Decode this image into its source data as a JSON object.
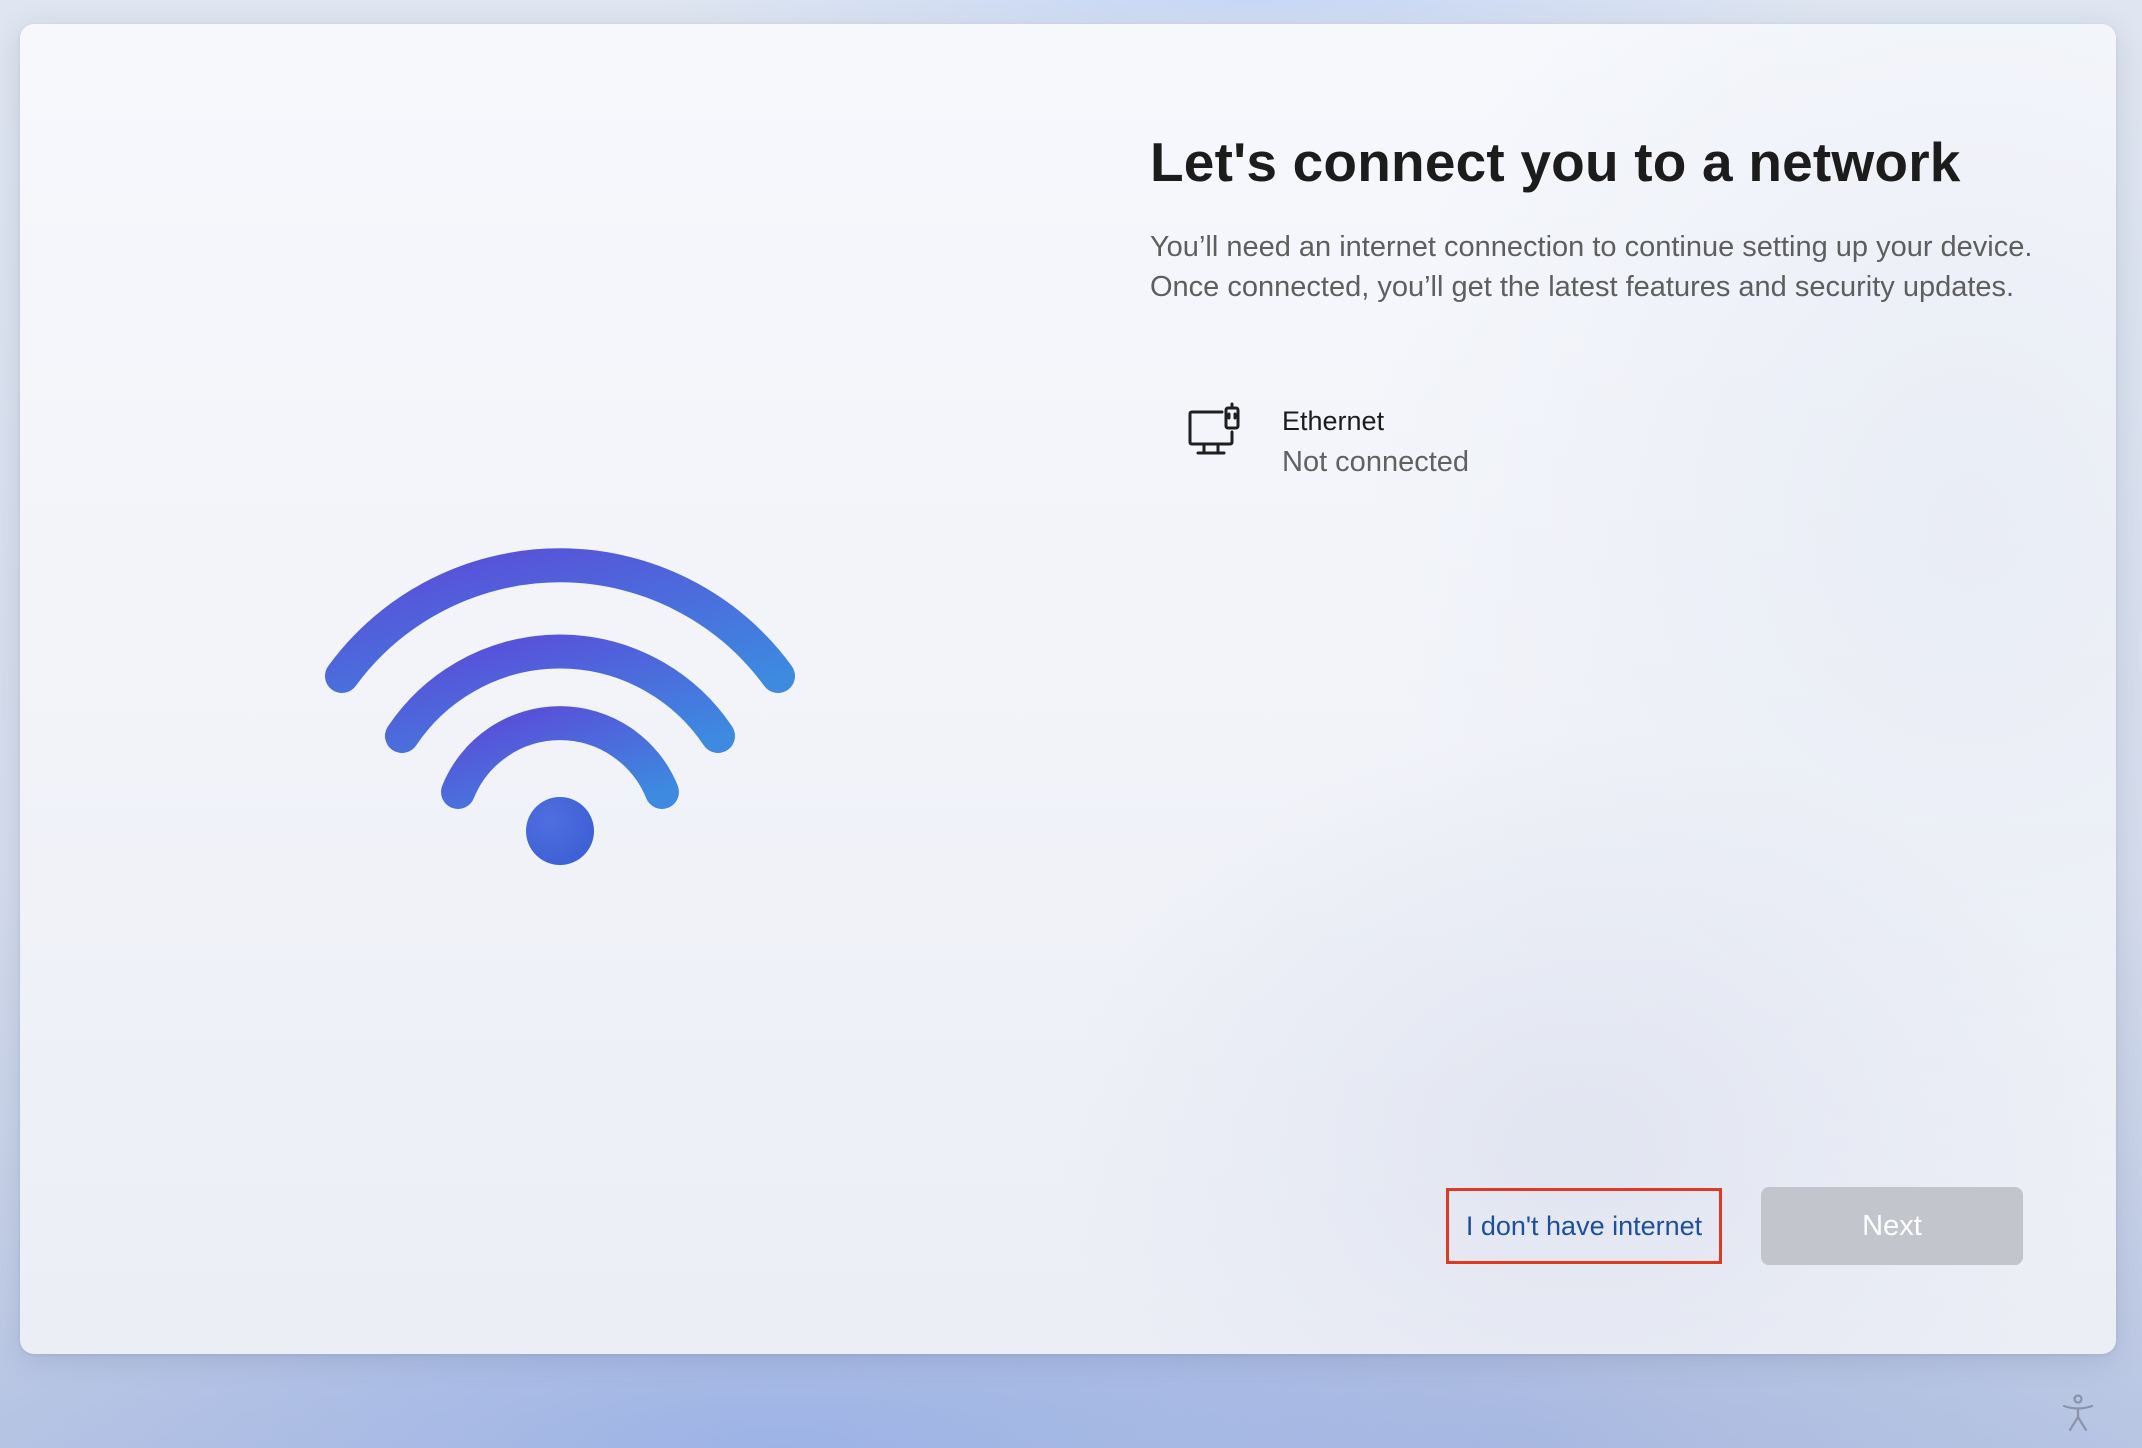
{
  "page": {
    "title": "Let's connect you to a network",
    "description": "You’ll need an internet connection to continue setting up your device. Once connected, you’ll get the latest features and security updates."
  },
  "networks": [
    {
      "name": "Ethernet",
      "status": "Not connected",
      "icon": "ethernet-monitor-icon"
    }
  ],
  "actions": {
    "no_internet_label": "I don't have internet",
    "next_label": "Next",
    "next_enabled": false
  },
  "illustration": {
    "icon": "wifi-icon",
    "colors": {
      "start": "#5a4fd6",
      "end": "#3f86e0"
    }
  },
  "footer": {
    "accessibility_icon": "accessibility-icon"
  }
}
